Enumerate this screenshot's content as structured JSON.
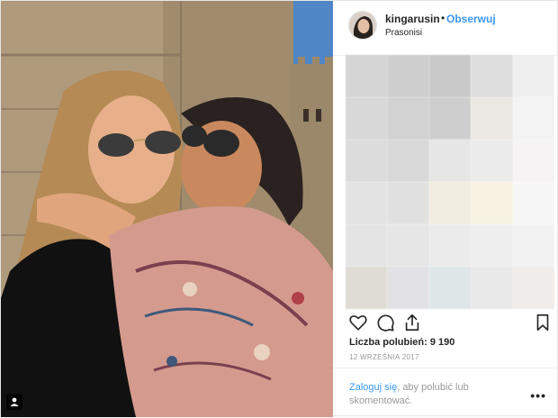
{
  "header": {
    "username": "kingarusin",
    "separator": "•",
    "follow_label": "Obserwuj",
    "location": "Prasonisi"
  },
  "post": {
    "likes_text": "Liczba polubień: 9 190",
    "date": "12 WRZEŚNIA 2017",
    "login_link": "Zaloguj się",
    "login_rest": ", aby polubić lub skomentować.",
    "more": "•••"
  },
  "colors": {
    "accent": "#3897f0",
    "text": "#262626",
    "muted": "#999999"
  },
  "icons": [
    "heart-icon",
    "comment-icon",
    "share-icon",
    "bookmark-icon",
    "user-tag-icon"
  ],
  "blur_cells": [
    "#d5d5d5",
    "#cfcfcf",
    "#c9c9c9",
    "#dedede",
    "#efefef",
    "#d8d8d8",
    "#d2d2d2",
    "#cecece",
    "#ece9e4",
    "#f3f3f3",
    "#dcdcdc",
    "#d9d9d9",
    "#e6e6e6",
    "#ebebeb",
    "#f5f3f3",
    "#e3e3e3",
    "#e1e1e1",
    "#f1ede0",
    "#f7f2e2",
    "#f7f7f7",
    "#e4e4e4",
    "#e6e6e6",
    "#ebebeb",
    "#eeeeee",
    "#f2f2f2",
    "#dedcd4",
    "#e2e2e4",
    "#dfe6e8",
    "#e8e8e8",
    "#efecea"
  ]
}
